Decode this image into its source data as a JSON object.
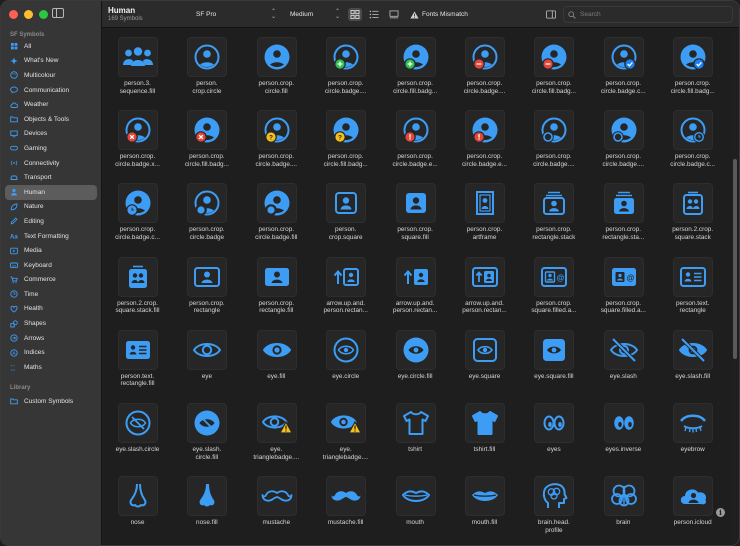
{
  "toolbar": {
    "title": "Human",
    "subtitle": "169 Symbols",
    "font_value": "SF Pro",
    "weight_value": "Medium",
    "mismatch_label": "Fonts Mismatch",
    "search_placeholder": "Search"
  },
  "sidebar": {
    "header": "SF Symbols",
    "library_header": "Library",
    "items": [
      {
        "label": "All",
        "icon": "grid-icon"
      },
      {
        "label": "What's New",
        "icon": "sparkle-icon"
      },
      {
        "label": "Multicolour",
        "icon": "paintpalette-icon"
      },
      {
        "label": "Communication",
        "icon": "bubble-icon"
      },
      {
        "label": "Weather",
        "icon": "cloud-icon"
      },
      {
        "label": "Objects & Tools",
        "icon": "folder-icon"
      },
      {
        "label": "Devices",
        "icon": "desktop-icon"
      },
      {
        "label": "Gaming",
        "icon": "gamecontroller-icon"
      },
      {
        "label": "Connectivity",
        "icon": "antenna-icon"
      },
      {
        "label": "Transport",
        "icon": "car-icon"
      },
      {
        "label": "Human",
        "icon": "person-icon",
        "selected": true
      },
      {
        "label": "Nature",
        "icon": "leaf-icon"
      },
      {
        "label": "Editing",
        "icon": "pencil-icon"
      },
      {
        "label": "Text Formatting",
        "icon": "textformat-icon"
      },
      {
        "label": "Media",
        "icon": "play-icon"
      },
      {
        "label": "Keyboard",
        "icon": "keyboard-icon"
      },
      {
        "label": "Commerce",
        "icon": "cart-icon"
      },
      {
        "label": "Time",
        "icon": "clock-icon"
      },
      {
        "label": "Health",
        "icon": "heart-icon"
      },
      {
        "label": "Shapes",
        "icon": "shapes-icon"
      },
      {
        "label": "Arrows",
        "icon": "arrows-icon"
      },
      {
        "label": "Indices",
        "icon": "indices-icon"
      },
      {
        "label": "Maths",
        "icon": "math-icon"
      }
    ],
    "library_items": [
      {
        "label": "Custom Symbols",
        "icon": "folder-icon"
      }
    ]
  },
  "colors": {
    "accent": "#3d9df5",
    "green_badge": "#2fc14f",
    "red_badge": "#e5453a",
    "yellow_badge": "#f5c01c",
    "blue_badge": "#1b82f5"
  },
  "symbols": [
    {
      "label": "person.3.\nsequence.fill",
      "icon": "person3"
    },
    {
      "label": "person.\ncrop.circle",
      "icon": "pcc"
    },
    {
      "label": "person.crop.\ncircle.fill",
      "icon": "pccf"
    },
    {
      "label": "person.crop.\ncircle.badge....",
      "icon": "pcc",
      "badge": "plus"
    },
    {
      "label": "person.crop.\ncircle.fill.badg...",
      "icon": "pccf",
      "badge": "plus"
    },
    {
      "label": "person.crop.\ncircle.badge....",
      "icon": "pcc",
      "badge": "minus"
    },
    {
      "label": "person.crop.\ncircle.fill.badg...",
      "icon": "pccf",
      "badge": "minus"
    },
    {
      "label": "person.crop.\ncircle.badge.c...",
      "icon": "pcc",
      "badge": "check"
    },
    {
      "label": "person.crop.\ncircle.fill.badg...",
      "icon": "pccf",
      "badge": "check"
    },
    {
      "label": "person.crop.\ncircle.badge.x...",
      "icon": "pcc",
      "badge": "x"
    },
    {
      "label": "person.crop.\ncircle.fill.badg...",
      "icon": "pccf",
      "badge": "x"
    },
    {
      "label": "person.crop.\ncircle.badge....",
      "icon": "pcc",
      "badge": "q"
    },
    {
      "label": "person.crop.\ncircle.fill.badg...",
      "icon": "pccf",
      "badge": "q"
    },
    {
      "label": "person.crop.\ncircle.badge.e...",
      "icon": "pcc",
      "badge": "excl"
    },
    {
      "label": "person.crop.\ncircle.badge.e...",
      "icon": "pccf",
      "badge": "excl"
    },
    {
      "label": "person.crop.\ncircle.badge....",
      "icon": "pcc",
      "badge": "ring"
    },
    {
      "label": "person.crop.\ncircle.badge....",
      "icon": "pccf",
      "badge": "ring"
    },
    {
      "label": "person.crop.\ncircle.badge.c...",
      "icon": "pcc",
      "badge": "clock"
    },
    {
      "label": "person.crop.\ncircle.badge.c...",
      "icon": "pccf",
      "badge": "clockl"
    },
    {
      "label": "person.crop.\ncircle.badge",
      "icon": "pcc",
      "badge": "dot"
    },
    {
      "label": "person.crop.\ncircle.badge.fill",
      "icon": "pccf",
      "badge": "dot"
    },
    {
      "label": "person.\ncrop.square",
      "icon": "pcs"
    },
    {
      "label": "person.crop.\nsquare.fill",
      "icon": "pcsf"
    },
    {
      "label": "person.crop.\nartframe",
      "icon": "artframe"
    },
    {
      "label": "person.crop.\nrectangle.stack",
      "icon": "rstack"
    },
    {
      "label": "person.crop.\nrectangle.sta...",
      "icon": "rstackf"
    },
    {
      "label": "person.2.crop.\nsquare.stack",
      "icon": "p2stack"
    },
    {
      "label": "person.2.crop.\nsquare.stack.fill",
      "icon": "p2stackf"
    },
    {
      "label": "person.crop.\nrectangle",
      "icon": "prect"
    },
    {
      "label": "person.crop.\nrectangle.fill",
      "icon": "prectf"
    },
    {
      "label": "arrow.up.and.\nperson.rectan...",
      "icon": "arrowp"
    },
    {
      "label": "arrow.up.and.\nperson.rectan...",
      "icon": "arrowp2"
    },
    {
      "label": "arrow.up.and.\nperson.rectan...",
      "icon": "arrowp3"
    },
    {
      "label": "person.crop.\nsquare.filled.a...",
      "icon": "pcard"
    },
    {
      "label": "person.crop.\nsquare.filled.a...",
      "icon": "pcardf"
    },
    {
      "label": "person.text.\nrectangle",
      "icon": "ptext"
    },
    {
      "label": "person.text.\nrectangle.fill",
      "icon": "ptextf"
    },
    {
      "label": "eye",
      "icon": "eye"
    },
    {
      "label": "eye.fill",
      "icon": "eyef"
    },
    {
      "label": "eye.circle",
      "icon": "eyec"
    },
    {
      "label": "eye.circle.fill",
      "icon": "eyecf"
    },
    {
      "label": "eye.square",
      "icon": "eyes"
    },
    {
      "label": "eye.square.fill",
      "icon": "eyesf"
    },
    {
      "label": "eye.slash",
      "icon": "eyeslash"
    },
    {
      "label": "eye.slash.fill",
      "icon": "eyeslashf"
    },
    {
      "label": "eye.slash.circle",
      "icon": "eyeslashc"
    },
    {
      "label": "eye.slash.\ncircle.fill",
      "icon": "eyeslashcf"
    },
    {
      "label": "eye.\ntrianglebadge....",
      "icon": "eyetri"
    },
    {
      "label": "eye.\ntrianglebadge....",
      "icon": "eyetrif"
    },
    {
      "label": "tshirt",
      "icon": "tshirt"
    },
    {
      "label": "tshirt.fill",
      "icon": "tshirtf"
    },
    {
      "label": "eyes",
      "icon": "eyes2"
    },
    {
      "label": "eyes.inverse",
      "icon": "eyesinv"
    },
    {
      "label": "eyebrow",
      "icon": "eyebrow"
    },
    {
      "label": "nose",
      "icon": "nose"
    },
    {
      "label": "nose.fill",
      "icon": "nosef"
    },
    {
      "label": "mustache",
      "icon": "mustache"
    },
    {
      "label": "mustache.fill",
      "icon": "mustachef"
    },
    {
      "label": "mouth",
      "icon": "mouth"
    },
    {
      "label": "mouth.fill",
      "icon": "mouthf"
    },
    {
      "label": "brain.head.\nprofile",
      "icon": "brainhead"
    },
    {
      "label": "brain",
      "icon": "brain"
    },
    {
      "label": "person.icloud",
      "icon": "picloud"
    }
  ]
}
